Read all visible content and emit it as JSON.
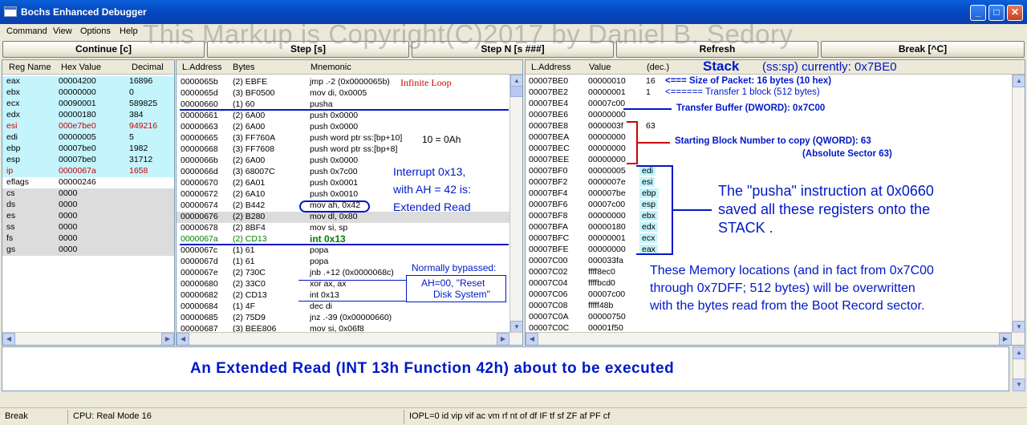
{
  "window": {
    "title": "Bochs Enhanced Debugger",
    "min": "_",
    "max": "□",
    "close": "✕"
  },
  "watermark": "This Markup is Copyright(C)2017 by Daniel B. Sedory",
  "menu": [
    "Command",
    "View",
    "Options",
    "Help"
  ],
  "buttons": {
    "continue": "Continue [c]",
    "step": "Step [s]",
    "stepn": "Step N [s ###]",
    "refresh": "Refresh",
    "break": "Break [^C]"
  },
  "registers": {
    "headers": [
      "Reg Name",
      "Hex Value",
      "Decimal"
    ],
    "rows": [
      {
        "name": "eax",
        "hex": "00004200",
        "dec": "16896",
        "hl": true,
        "red": false
      },
      {
        "name": "ebx",
        "hex": "00000000",
        "dec": "0",
        "hl": true,
        "red": false
      },
      {
        "name": "ecx",
        "hex": "00090001",
        "dec": "589825",
        "hl": true,
        "red": false
      },
      {
        "name": "edx",
        "hex": "00000180",
        "dec": "384",
        "hl": true,
        "red": false
      },
      {
        "name": "esi",
        "hex": "000e7be0",
        "dec": "949216",
        "hl": true,
        "red": true
      },
      {
        "name": "edi",
        "hex": "00000005",
        "dec": "5",
        "hl": true,
        "red": false
      },
      {
        "name": "ebp",
        "hex": "00007be0",
        "dec": "1982",
        "hl": true,
        "red": false
      },
      {
        "name": "esp",
        "hex": "00007be0",
        "dec": "31712",
        "hl": true,
        "red": false
      },
      {
        "name": "ip",
        "hex": "0000067a",
        "dec": "1658",
        "hl": true,
        "red": true
      },
      {
        "name": "eflags",
        "hex": "00000246",
        "dec": "",
        "hl": false,
        "red": false
      },
      {
        "name": "cs",
        "hex": "0000",
        "dec": "",
        "hl": "gray",
        "red": false
      },
      {
        "name": "ds",
        "hex": "0000",
        "dec": "",
        "hl": "gray",
        "red": false
      },
      {
        "name": "es",
        "hex": "0000",
        "dec": "",
        "hl": "gray",
        "red": false
      },
      {
        "name": "ss",
        "hex": "0000",
        "dec": "",
        "hl": "gray",
        "red": false
      },
      {
        "name": "fs",
        "hex": "0000",
        "dec": "",
        "hl": "gray",
        "red": false
      },
      {
        "name": "gs",
        "hex": "0000",
        "dec": "",
        "hl": "gray",
        "red": false
      }
    ]
  },
  "disasm": {
    "headers": [
      "L.Address",
      "Bytes",
      "Mnemonic"
    ],
    "rows": [
      {
        "addr": "0000065b",
        "bytes": "(2) EBFE",
        "mn": "jmp .-2 (0x0000065b)"
      },
      {
        "addr": "0000065d",
        "bytes": "(3) BF0500",
        "mn": "mov di, 0x0005"
      },
      {
        "addr": "00000660",
        "bytes": "(1) 60",
        "mn": "pusha"
      },
      {
        "addr": "00000661",
        "bytes": "(2) 6A00",
        "mn": "push 0x0000"
      },
      {
        "addr": "00000663",
        "bytes": "(2) 6A00",
        "mn": "push 0x0000"
      },
      {
        "addr": "00000665",
        "bytes": "(3) FF760A",
        "mn": "push word ptr ss:[bp+10]"
      },
      {
        "addr": "00000668",
        "bytes": "(3) FF7608",
        "mn": "push word ptr ss:[bp+8]"
      },
      {
        "addr": "0000066b",
        "bytes": "(2) 6A00",
        "mn": "push 0x0000"
      },
      {
        "addr": "0000066d",
        "bytes": "(3) 68007C",
        "mn": "push 0x7c00"
      },
      {
        "addr": "00000670",
        "bytes": "(2) 6A01",
        "mn": "push 0x0001"
      },
      {
        "addr": "00000672",
        "bytes": "(2) 6A10",
        "mn": "push 0x0010"
      },
      {
        "addr": "00000674",
        "bytes": "(2) B442",
        "mn": "mov ah, 0x42"
      },
      {
        "addr": "00000676",
        "bytes": "(2) B280",
        "mn": "mov dl, 0x80"
      },
      {
        "addr": "00000678",
        "bytes": "(2) 8BF4",
        "mn": "mov si, sp"
      },
      {
        "addr": "0000067a",
        "bytes": "(2) CD13",
        "mn": "int 0x13"
      },
      {
        "addr": "0000067c",
        "bytes": "(1) 61",
        "mn": "popa"
      },
      {
        "addr": "0000067d",
        "bytes": "(1) 61",
        "mn": "popa"
      },
      {
        "addr": "0000067e",
        "bytes": "(2) 730C",
        "mn": "jnb .+12 (0x0000068c)"
      },
      {
        "addr": "00000680",
        "bytes": "(2) 33C0",
        "mn": "xor ax, ax"
      },
      {
        "addr": "00000682",
        "bytes": "(2) CD13",
        "mn": "int 0x13"
      },
      {
        "addr": "00000684",
        "bytes": "(1) 4F",
        "mn": "dec di"
      },
      {
        "addr": "00000685",
        "bytes": "(2) 75D9",
        "mn": "jnz .-39 (0x00000660)"
      },
      {
        "addr": "00000687",
        "bytes": "(3) BEE806",
        "mn": "mov si, 0x06f8"
      }
    ]
  },
  "stack": {
    "headers": [
      "L.Address",
      "Value",
      "(dec.)"
    ],
    "title_bold": "Stack",
    "title_rest": "(ss:sp) currently: 0x7BE0",
    "rows": [
      {
        "addr": "00007BE0",
        "val": "00000010",
        "dec": "16"
      },
      {
        "addr": "00007BE2",
        "val": "00000001",
        "dec": "1"
      },
      {
        "addr": "00007BE4",
        "val": "00007c00",
        "dec": ""
      },
      {
        "addr": "00007BE6",
        "val": "00000000",
        "dec": ""
      },
      {
        "addr": "00007BE8",
        "val": "0000003f",
        "dec": "63"
      },
      {
        "addr": "00007BEA",
        "val": "00000000",
        "dec": ""
      },
      {
        "addr": "00007BEC",
        "val": "00000000",
        "dec": ""
      },
      {
        "addr": "00007BEE",
        "val": "00000000",
        "dec": ""
      },
      {
        "addr": "00007BF0",
        "val": "00000005",
        "dec": "edi"
      },
      {
        "addr": "00007BF2",
        "val": "0000007e",
        "dec": "esi"
      },
      {
        "addr": "00007BF4",
        "val": "000007be",
        "dec": "ebp"
      },
      {
        "addr": "00007BF6",
        "val": "00007c00",
        "dec": "esp"
      },
      {
        "addr": "00007BF8",
        "val": "00000000",
        "dec": "ebx"
      },
      {
        "addr": "00007BFA",
        "val": "00000180",
        "dec": "edx"
      },
      {
        "addr": "00007BFC",
        "val": "00000001",
        "dec": "ecx"
      },
      {
        "addr": "00007BFE",
        "val": "00000000",
        "dec": "eax"
      },
      {
        "addr": "00007C00",
        "val": "000033fa",
        "dec": ""
      },
      {
        "addr": "00007C02",
        "val": "ffff8ec0",
        "dec": ""
      },
      {
        "addr": "00007C04",
        "val": "ffffbcd0",
        "dec": ""
      },
      {
        "addr": "00007C06",
        "val": "00007c00",
        "dec": ""
      },
      {
        "addr": "00007C08",
        "val": "fffff48b",
        "dec": ""
      },
      {
        "addr": "00007C0A",
        "val": "00000750",
        "dec": ""
      },
      {
        "addr": "00007C0C",
        "val": "00001f50",
        "dec": ""
      }
    ]
  },
  "annotations": {
    "infinite_loop": "Infinite Loop",
    "ten_hex": "10 = 0Ah",
    "interrupt1": "Interrupt 0x13,",
    "interrupt2": "with AH = 42 is:",
    "interrupt3": "Extended  Read",
    "bypass_title": "Normally bypassed:",
    "bypass1": "AH=00, \"Reset",
    "bypass2": "Disk System\"",
    "packet_size": "<=== Size of Packet: 16 bytes (10 hex)",
    "transfer_one": "<====== Transfer 1 block (512 bytes)",
    "transfer_buffer": "Transfer Buffer (DWORD): 0x7C00",
    "start_block": "Starting Block Number to copy (QWORD):  63",
    "abs_sector": "(Absolute Sector 63)",
    "pusha1": "The \"pusha\" instruction at 0x0660",
    "pusha2": "saved all these registers onto the",
    "pusha3": "STACK .",
    "mem1": "These Memory locations (and in fact from 0x7C00",
    "mem2": "through 0x7DFF; 512 bytes) will be overwritten",
    "mem3": "with the bytes read from the Boot Record sector."
  },
  "output": "An Extended Read (INT 13h Function 42h) about to be executed",
  "status": {
    "break": "Break",
    "cpu": "CPU: Real Mode 16",
    "flags": "IOPL=0 id vip vif ac vm rf nt of df IF tf sf ZF af PF cf"
  },
  "colors": {
    "highlight": "#c4f4fc",
    "gray": "#dcdcdc",
    "accent": "#0018c8",
    "red": "#d00000",
    "green": "#008000"
  }
}
